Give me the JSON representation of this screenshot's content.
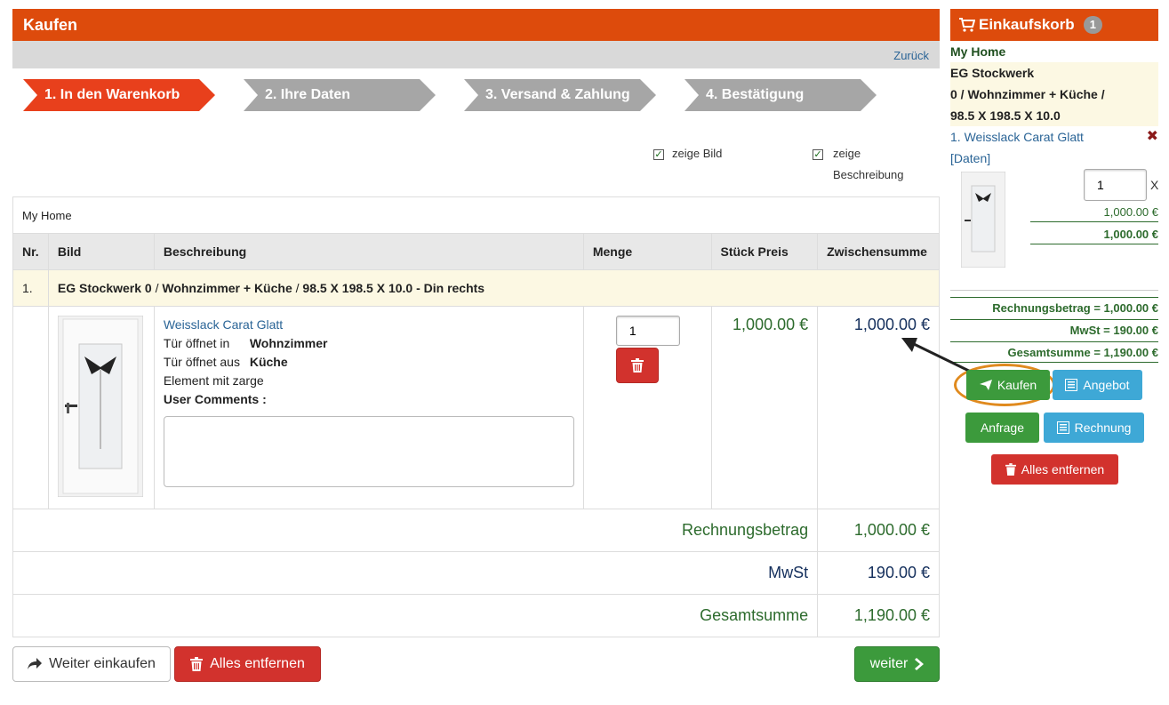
{
  "header": {
    "title": "Kaufen",
    "back_link": "Zurück"
  },
  "steps": [
    "1. In den Warenkorb",
    "2. Ihre Daten",
    "3. Versand & Zahlung",
    "4. Bestätigung"
  ],
  "options": {
    "show_image": {
      "label": "zeige Bild",
      "checked": true
    },
    "show_desc": {
      "label_line1": "zeige",
      "label_line2": "Beschreibung",
      "checked": true
    }
  },
  "cart": {
    "group_name": "My Home",
    "columns": [
      "Nr.",
      "Bild",
      "Beschreibung",
      "Menge",
      "Stück Preis",
      "Zwischensumme"
    ],
    "group_row": {
      "nr": "1.",
      "part1": "EG Stockwerk 0",
      "sep1": " / ",
      "part2": "Wohnzimmer + Küche",
      "sep2": " / ",
      "part3": "98.5 X 198.5 X 10.0 - Din rechts"
    },
    "item": {
      "name": "Weisslack Carat Glatt",
      "opens_in_label": "Tür öffnet in",
      "opens_in_value": "Wohnzimmer",
      "opens_out_label": "Tür öffnet aus",
      "opens_out_value": "Küche",
      "element": "Element mit zarge",
      "comments_label": "User Comments :",
      "comments_value": "",
      "quantity": "1",
      "unit_price": "1,000.00 €",
      "subtotal": "1,000.00 €"
    },
    "totals": [
      {
        "label": "Rechnungsbetrag",
        "value": "1,000.00 €"
      },
      {
        "label": "MwSt",
        "value": "190.00 €"
      },
      {
        "label": "Gesamtsumme",
        "value": "1,190.00 €"
      }
    ]
  },
  "bottom_buttons": {
    "continue_shopping": "Weiter einkaufen",
    "remove_all": "Alles entfernen",
    "next": "weiter"
  },
  "sidebar": {
    "title": "Einkaufskorb",
    "count": "1",
    "group": "My Home",
    "floor_line1": "EG Stockwerk",
    "floor_line2": "0 / Wohnzimmer + Küche /",
    "floor_line3": "98.5 X 198.5 X 10.0",
    "item_name": "1. Weisslack Carat Glatt",
    "item_data_link": "[Daten]",
    "quantity": "1",
    "times": "X",
    "unit_price": "1,000.00 €",
    "line_total": "1,000.00 €",
    "invoice": "Rechnungsbetrag = 1,000.00 €",
    "tax": "MwSt = 190.00 €",
    "total": "Gesamtsumme = 1,190.00 €",
    "buttons": {
      "buy": "Kaufen",
      "offer": "Angebot",
      "inquiry": "Anfrage",
      "bill": "Rechnung",
      "remove_all": "Alles entfernen"
    }
  },
  "colors": {
    "brand": "#dd4b0c",
    "active_step": "#e8401c",
    "green_button": "#3c9a3c",
    "blue_button": "#3ea8d6",
    "red_button": "#d2322d",
    "highlight_ring": "#e08a1e"
  }
}
